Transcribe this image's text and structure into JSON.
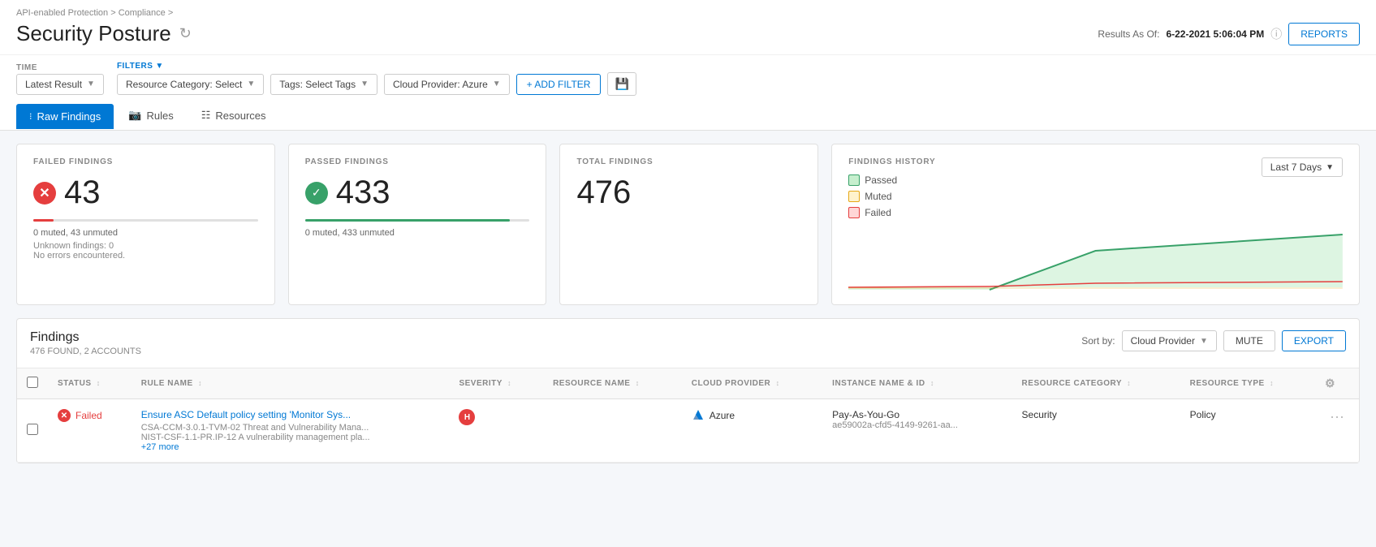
{
  "breadcrumb": {
    "part1": "API-enabled Protection",
    "part2": "Compliance"
  },
  "page": {
    "title": "Security Posture",
    "results_as_of": "Results As Of:",
    "results_date": "6-22-2021 5:06:04 PM"
  },
  "toolbar": {
    "time_label": "TIME",
    "filters_label": "FILTERS",
    "latest_result": "Latest Result",
    "resource_category": "Resource Category: Select",
    "tags": "Tags: Select Tags",
    "cloud_provider": "Cloud Provider: Azure",
    "add_filter": "+ ADD FILTER",
    "reports_btn": "REPORTS"
  },
  "tabs": [
    {
      "id": "raw-findings",
      "label": "Raw Findings",
      "active": true
    },
    {
      "id": "rules",
      "label": "Rules",
      "active": false
    },
    {
      "id": "resources",
      "label": "Resources",
      "active": false
    }
  ],
  "metrics": {
    "failed": {
      "label": "FAILED FINDINGS",
      "value": "43",
      "sub": "0 muted, 43 unmuted",
      "unknown": "Unknown findings: 0",
      "errors": "No errors encountered."
    },
    "passed": {
      "label": "PASSED FINDINGS",
      "value": "433",
      "sub": "0 muted, 433 unmuted"
    },
    "total": {
      "label": "TOTAL FINDINGS",
      "value": "476"
    }
  },
  "history": {
    "title": "FINDINGS HISTORY",
    "period": "Last 7 Days",
    "legend": [
      {
        "id": "passed",
        "label": "Passed",
        "color": "#38a169"
      },
      {
        "id": "muted",
        "label": "Muted",
        "color": "#e6a817"
      },
      {
        "id": "failed",
        "label": "Failed",
        "color": "#e53e3e"
      }
    ]
  },
  "findings_table": {
    "title": "Findings",
    "subtitle": "476 FOUND, 2 ACCOUNTS",
    "sort_by_label": "Sort by:",
    "sort_by": "Cloud Provider",
    "mute_btn": "MUTE",
    "export_btn": "EXPORT",
    "columns": [
      {
        "id": "status",
        "label": "STATUS"
      },
      {
        "id": "rule-name",
        "label": "RULE NAME"
      },
      {
        "id": "severity",
        "label": "SEVERITY"
      },
      {
        "id": "resource-name",
        "label": "RESOURCE NAME"
      },
      {
        "id": "cloud-provider",
        "label": "CLOUD PROVIDER"
      },
      {
        "id": "instance-name",
        "label": "INSTANCE NAME & ID"
      },
      {
        "id": "resource-category",
        "label": "RESOURCE CATEGORY"
      },
      {
        "id": "resource-type",
        "label": "RESOURCE TYPE"
      }
    ],
    "rows": [
      {
        "status": "Failed",
        "rule_name": "Ensure ASC Default policy setting 'Monitor Sys...",
        "rule_meta1": "CSA-CCM-3.0.1-TVM-02 Threat and Vulnerability Mana...",
        "rule_meta2": "NIST-CSF-1.1-PR.IP-12 A vulnerability management pla...",
        "rule_meta3": "+27 more",
        "severity": "H",
        "resource_name": "",
        "cloud_provider": "Azure",
        "instance_name": "Pay-As-You-Go",
        "instance_id": "ae59002a-cfd5-4149-9261-aa...",
        "resource_category": "Security",
        "resource_type": "Policy",
        "actions": "..."
      }
    ]
  }
}
